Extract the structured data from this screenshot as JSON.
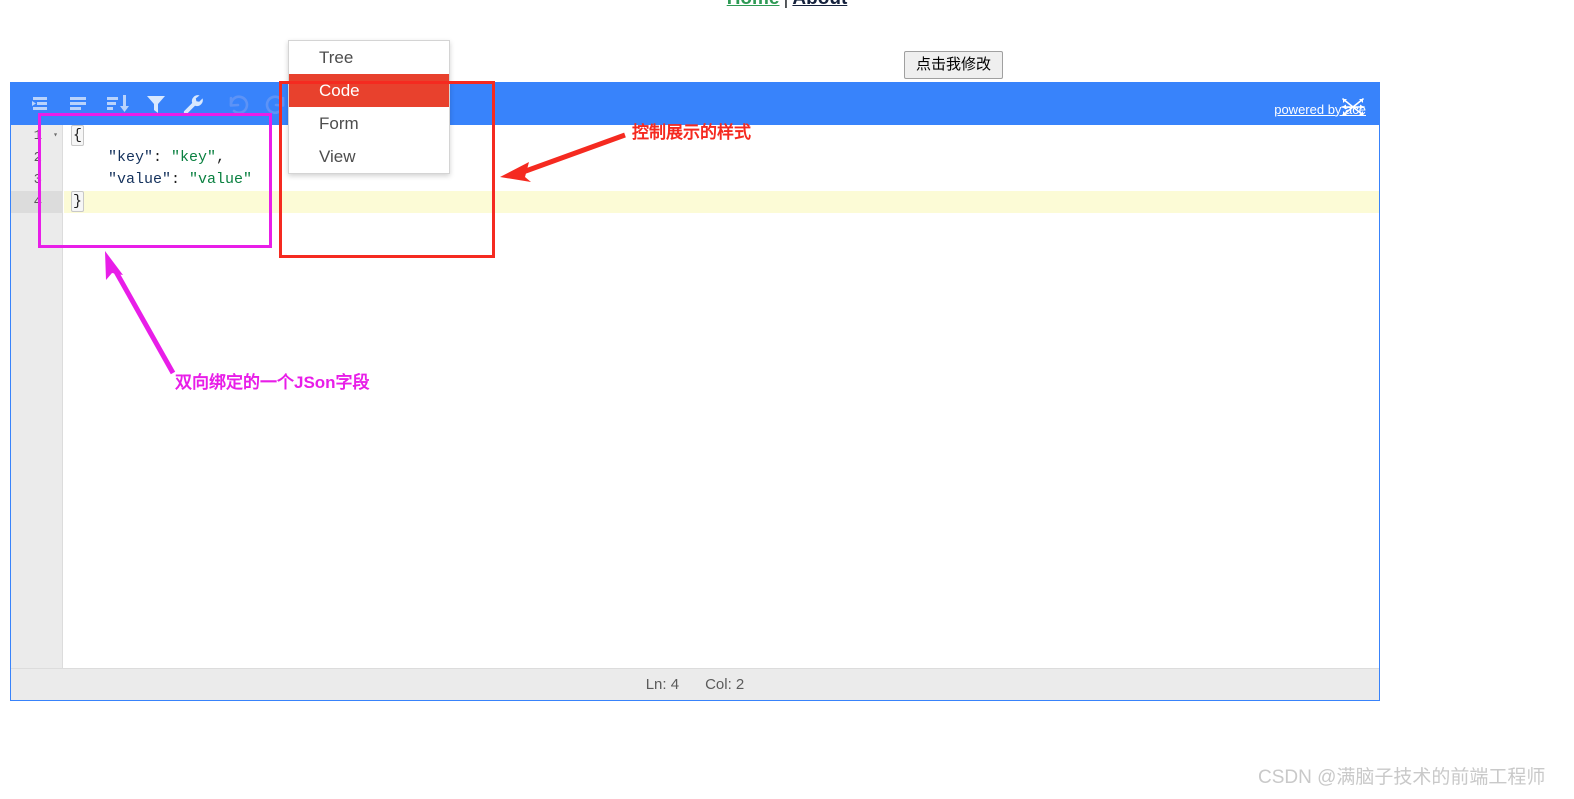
{
  "nav": {
    "home_label": "Home",
    "separator": "|",
    "about_label": "About",
    "home_color": "#2e9a55",
    "about_color": "#14213d"
  },
  "modify_button": {
    "label": "点击我修改"
  },
  "editor": {
    "accent_color": "#3883fb",
    "toolbar": {
      "icons": [
        {
          "name": "expand-all-icon",
          "title": "Expand all fields"
        },
        {
          "name": "collapse-all-icon",
          "title": "Collapse all fields"
        },
        {
          "name": "sort-icon",
          "title": "Sort contents"
        },
        {
          "name": "filter-icon",
          "title": "Filter, sort, or transform contents"
        },
        {
          "name": "wrench-icon",
          "title": "Repair JSON"
        },
        {
          "name": "undo-icon",
          "title": "Undo last action"
        },
        {
          "name": "redo-icon",
          "title": "Redo"
        }
      ],
      "mode_label": "Code",
      "caret": "▼",
      "powered_by_label": "powered by ace"
    },
    "mode_menu": {
      "items": [
        {
          "label": "Tree",
          "selected": false
        },
        {
          "label": "Code",
          "selected": true
        },
        {
          "label": "Form",
          "selected": false
        },
        {
          "label": "View",
          "selected": false
        }
      ],
      "selected_bg": "#e8412d"
    },
    "content": {
      "line_numbers": [
        "1",
        "2",
        "3",
        "4"
      ],
      "active_line": 4,
      "fold_marker": "▾",
      "lines": [
        {
          "open_brace": "{"
        },
        {
          "indent": "    ",
          "key": "\"key\"",
          "colon": ": ",
          "value": "\"key\"",
          "comma": ","
        },
        {
          "indent": "    ",
          "key": "\"value\"",
          "colon": ": ",
          "value": "\"value\"",
          "comma": ""
        },
        {
          "close_brace": "}"
        }
      ],
      "key_color": "#14315c",
      "string_color": "#0a8040",
      "active_line_color": "#fcfbd6"
    },
    "status_bar": {
      "line_label": "Ln: 4",
      "col_label": "Col: 2"
    }
  },
  "annotations": {
    "red": {
      "text": "控制展示的样式",
      "color": "#f52a20"
    },
    "magenta": {
      "text": "双向绑定的一个JSon字段",
      "color": "#e81ee8"
    }
  },
  "watermark": {
    "text": "CSDN @满脑子技术的前端工程师"
  }
}
